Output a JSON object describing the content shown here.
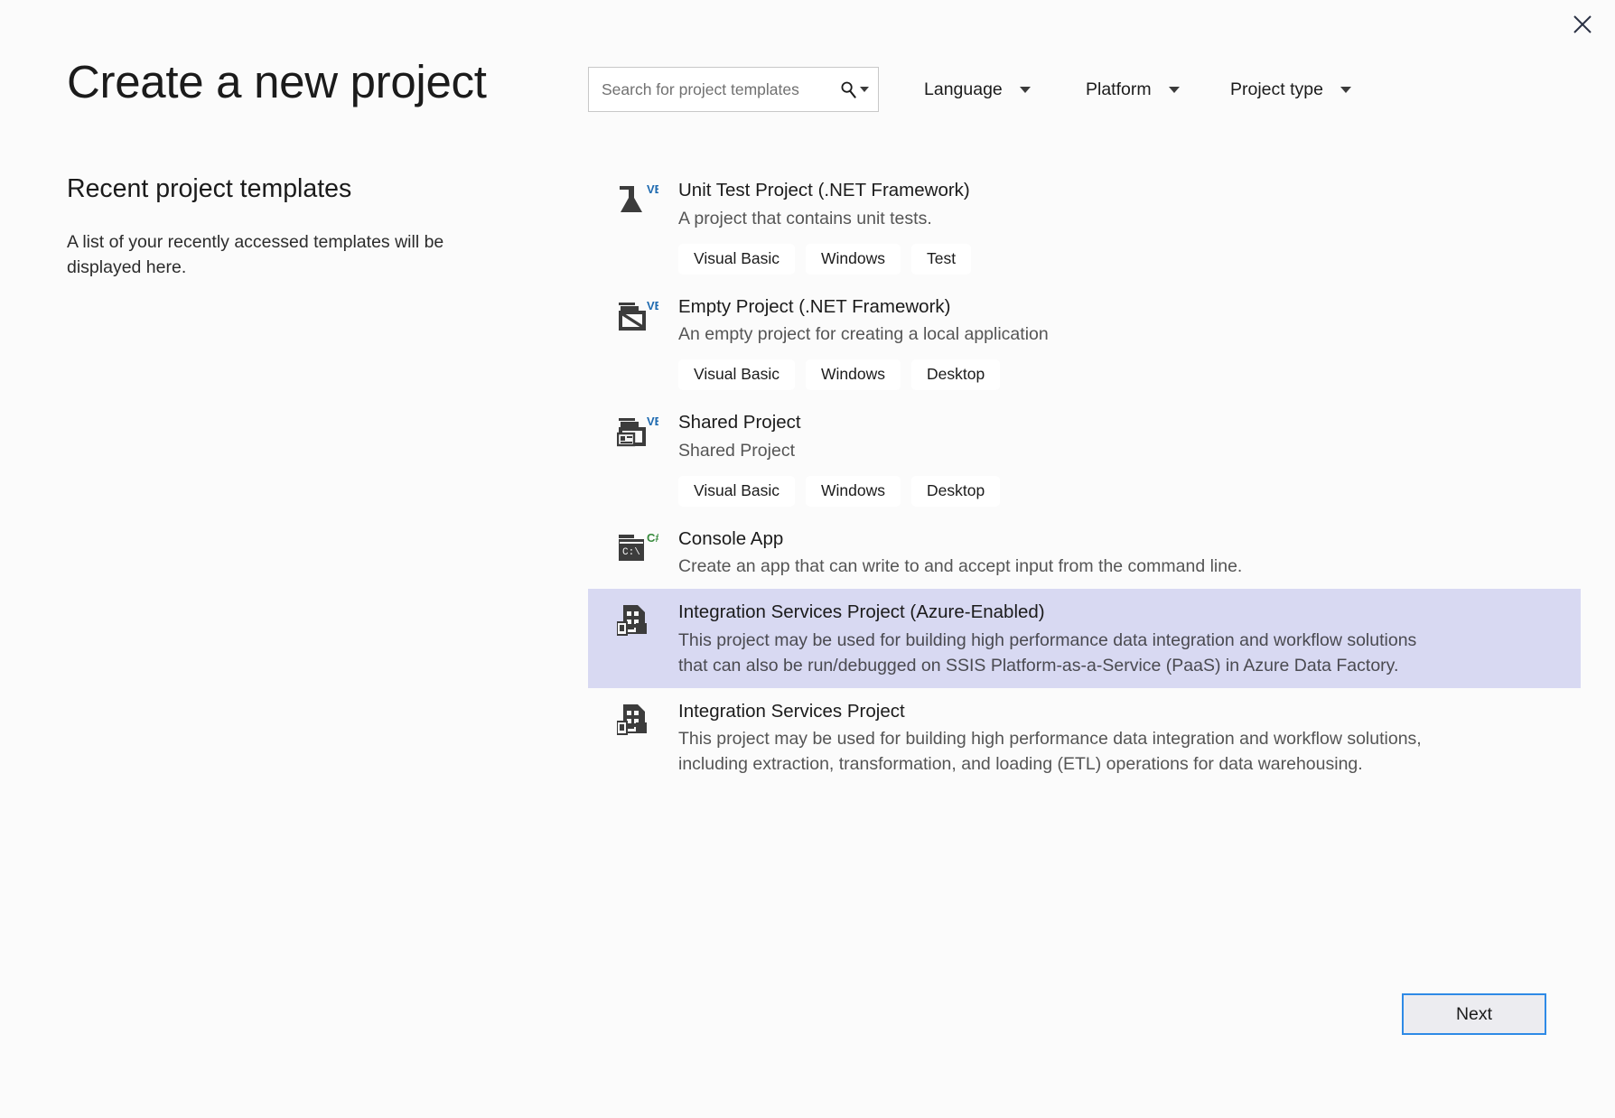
{
  "window": {
    "close_label": "×"
  },
  "header": {
    "title": "Create a new project",
    "search": {
      "placeholder": "Search for project templates",
      "value": "",
      "icon": "search-icon",
      "dropdown_icon": "chevron-down-icon"
    },
    "filters": [
      {
        "label": "Language",
        "icon": "chevron-down-icon"
      },
      {
        "label": "Platform",
        "icon": "chevron-down-icon"
      },
      {
        "label": "Project type",
        "icon": "chevron-down-icon"
      }
    ]
  },
  "sidebar": {
    "heading": "Recent project templates",
    "empty_message": "A list of your recently accessed templates will be displayed here."
  },
  "templates": [
    {
      "name": "Unit Test Project (.NET Framework)",
      "description": "A project that contains unit tests.",
      "icon": "flask-icon",
      "badge": "VB",
      "tags": [
        "Visual Basic",
        "Windows",
        "Test"
      ],
      "selected": false
    },
    {
      "name": "Empty Project (.NET Framework)",
      "description": "An empty project for creating a local application",
      "icon": "empty-folder-icon",
      "badge": "VB",
      "tags": [
        "Visual Basic",
        "Windows",
        "Desktop"
      ],
      "selected": false
    },
    {
      "name": "Shared Project",
      "description": "Shared Project",
      "icon": "shared-folder-icon",
      "badge": "VB",
      "tags": [
        "Visual Basic",
        "Windows",
        "Desktop"
      ],
      "selected": false
    },
    {
      "name": "Console App",
      "description": "Create an app that can write to and accept input from the command line.",
      "icon": "console-icon",
      "badge": "C#",
      "tags": [],
      "selected": false
    },
    {
      "name": "Integration Services Project (Azure-Enabled)",
      "description": "This project may be used for building high performance data integration and workflow solutions that can also be run/debugged on SSIS Platform-as-a-Service (PaaS) in Azure Data Factory.",
      "icon": "ssis-package-icon",
      "badge": "",
      "tags": [],
      "selected": true
    },
    {
      "name": "Integration Services Project",
      "description": "This project may be used for building high performance data integration and workflow solutions, including extraction, transformation, and loading (ETL) operations for data warehousing.",
      "icon": "ssis-package-icon",
      "badge": "",
      "tags": [],
      "selected": false
    }
  ],
  "footer": {
    "next_label": "Next"
  },
  "colors": {
    "background": "#fbfbfb",
    "selection": "#d8d9f2",
    "accent_blue": "#2e8ae6",
    "vb_badge": "#1e6ab0",
    "csharp_badge": "#378a3c",
    "icon_dark": "#3c3c3c"
  }
}
